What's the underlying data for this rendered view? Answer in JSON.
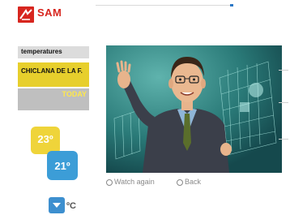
{
  "brand": {
    "name": "SAM",
    "color": "#d7261f"
  },
  "sidebar": {
    "section_label": "temperatures",
    "city": "CHICLANA DE LA F.",
    "day": "TODAY",
    "max_temp": "23º",
    "min_temp": "21º",
    "unit": "ºC"
  },
  "video": {
    "controls": [
      {
        "label": "Watch again"
      },
      {
        "label": "Back"
      }
    ]
  },
  "colors": {
    "accent_yellow": "#e7cf2c",
    "accent_blue": "#3c9dd7",
    "video_teal": "#1e5e62"
  },
  "icons": {
    "logo": "sam-logo-icon",
    "unit_toggle": "chevron-down-icon"
  }
}
